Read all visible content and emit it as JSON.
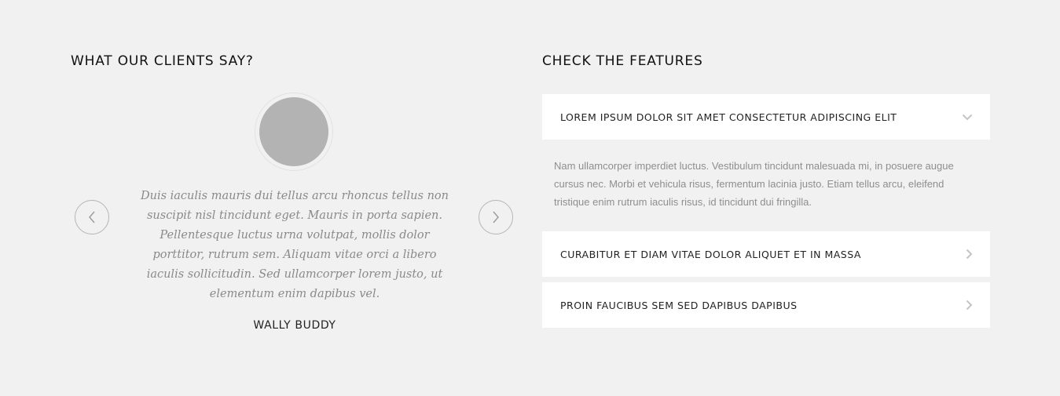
{
  "testimonials": {
    "title": "WHAT OUR CLIENTS SAY?",
    "quote": "Duis iaculis mauris dui tellus arcu rhoncus tellus non suscipit nisl tincidunt eget. Mauris in porta sapien. Pellentesque luctus urna volutpat, mollis dolor porttitor, rutrum sem. Aliquam vitae orci a libero iaculis sollicitudin. Sed ullamcorper lorem justo, ut elementum enim dapibus vel.",
    "author": "WALLY BUDDY",
    "prev_icon": "chevron-left-icon",
    "next_icon": "chevron-right-icon"
  },
  "features": {
    "title": "CHECK THE FEATURES",
    "items": [
      {
        "title": "LOREM IPSUM DOLOR SIT AMET CONSECTETUR ADIPISCING ELIT",
        "expanded": true,
        "icon": "chevron-down-icon",
        "body": "Nam ullamcorper imperdiet luctus. Vestibulum tincidunt malesuada mi, in posuere augue cursus nec. Morbi et vehicula risus, fermentum lacinia justo. Etiam tellus arcu, eleifend tristique enim rutrum iaculis risus, id tincidunt dui fringilla."
      },
      {
        "title": "CURABITUR ET DIAM VITAE DOLOR ALIQUET ET IN MASSA",
        "expanded": false,
        "icon": "chevron-right-icon"
      },
      {
        "title": "PROIN FAUCIBUS SEM SED DAPIBUS DAPIBUS",
        "expanded": false,
        "icon": "chevron-right-icon"
      }
    ]
  },
  "colors": {
    "background": "#f1f1f1",
    "panel": "#ffffff",
    "avatar_placeholder": "#b3b3b3",
    "muted_text": "#8a8a8a"
  }
}
